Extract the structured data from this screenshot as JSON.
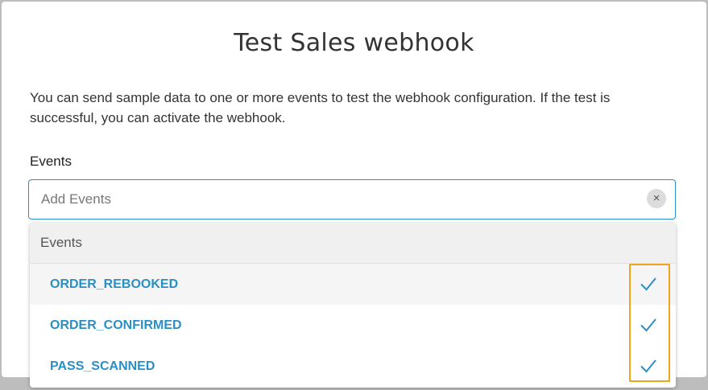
{
  "dialog": {
    "title": "Test Sales webhook",
    "description": "You can send sample data to one or more events to test the webhook configuration. If the test is successful, you can activate the webhook."
  },
  "events_field": {
    "label": "Events",
    "placeholder": "Add Events",
    "clear_icon": "×"
  },
  "dropdown": {
    "group_header": "Events",
    "options": [
      {
        "label": "ORDER_REBOOKED",
        "selected": true
      },
      {
        "label": "ORDER_CONFIRMED",
        "selected": true
      },
      {
        "label": "PASS_SCANNED",
        "selected": true
      }
    ]
  },
  "colors": {
    "accent": "#2a8fc4",
    "highlight_outline": "#f0a41e"
  }
}
